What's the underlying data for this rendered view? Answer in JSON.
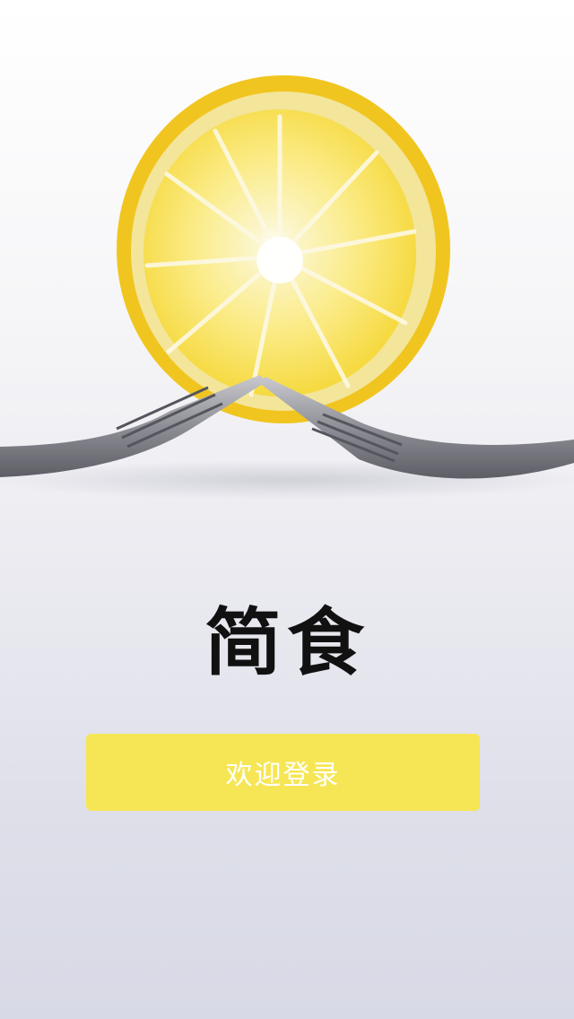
{
  "app": {
    "title": "简食"
  },
  "login": {
    "button_label": "欢迎登录"
  },
  "colors": {
    "button_background": "#f6e655",
    "button_text": "#ffffff",
    "title_text": "#111111"
  },
  "hero": {
    "image_subject": "lemon-slice-on-forks"
  }
}
